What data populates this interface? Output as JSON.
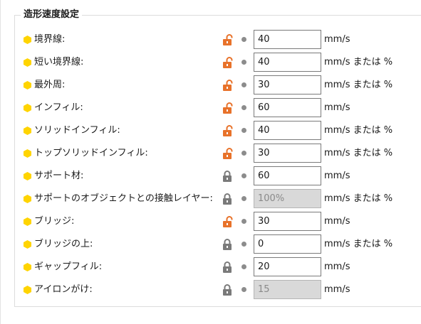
{
  "group": {
    "title": "造形速度設定"
  },
  "colors": {
    "bullet": "#ffd400",
    "lock_unlocked": "#e8722a",
    "lock_locked": "#7a7a7a",
    "field_disabled_bg": "#d9d9d9"
  },
  "rows": [
    {
      "label": "境界線:",
      "value": "40",
      "unit": "mm/s",
      "lock_icon": "unlocked-lock-icon",
      "locked": false,
      "disabled": false
    },
    {
      "label": "短い境界線:",
      "value": "40",
      "unit": "mm/s または %",
      "lock_icon": "unlocked-lock-icon",
      "locked": false,
      "disabled": false
    },
    {
      "label": "最外周:",
      "value": "30",
      "unit": "mm/s または %",
      "lock_icon": "unlocked-lock-icon",
      "locked": false,
      "disabled": false
    },
    {
      "label": "インフィル:",
      "value": "60",
      "unit": "mm/s",
      "lock_icon": "unlocked-lock-icon",
      "locked": false,
      "disabled": false
    },
    {
      "label": "ソリッドインフィル:",
      "value": "40",
      "unit": "mm/s または %",
      "lock_icon": "unlocked-lock-icon",
      "locked": false,
      "disabled": false
    },
    {
      "label": "トップソリッドインフィル:",
      "value": "30",
      "unit": "mm/s または %",
      "lock_icon": "unlocked-lock-icon",
      "locked": false,
      "disabled": false
    },
    {
      "label": "サポート材:",
      "value": "60",
      "unit": "mm/s",
      "lock_icon": "locked-lock-icon",
      "locked": true,
      "disabled": false
    },
    {
      "label": "サポートのオブジェクトとの接触レイヤー:",
      "value": "100%",
      "unit": "mm/s または %",
      "lock_icon": "locked-lock-icon",
      "locked": true,
      "disabled": true
    },
    {
      "label": "ブリッジ:",
      "value": "30",
      "unit": "mm/s",
      "lock_icon": "unlocked-lock-icon",
      "locked": false,
      "disabled": false
    },
    {
      "label": "ブリッジの上:",
      "value": "0",
      "unit": "mm/s または %",
      "lock_icon": "locked-lock-icon",
      "locked": true,
      "disabled": false
    },
    {
      "label": "ギャップフィル:",
      "value": "20",
      "unit": "mm/s",
      "lock_icon": "locked-lock-icon",
      "locked": true,
      "disabled": false
    },
    {
      "label": "アイロンがけ:",
      "value": "15",
      "unit": "mm/s",
      "lock_icon": "locked-lock-icon",
      "locked": true,
      "disabled": true
    }
  ]
}
